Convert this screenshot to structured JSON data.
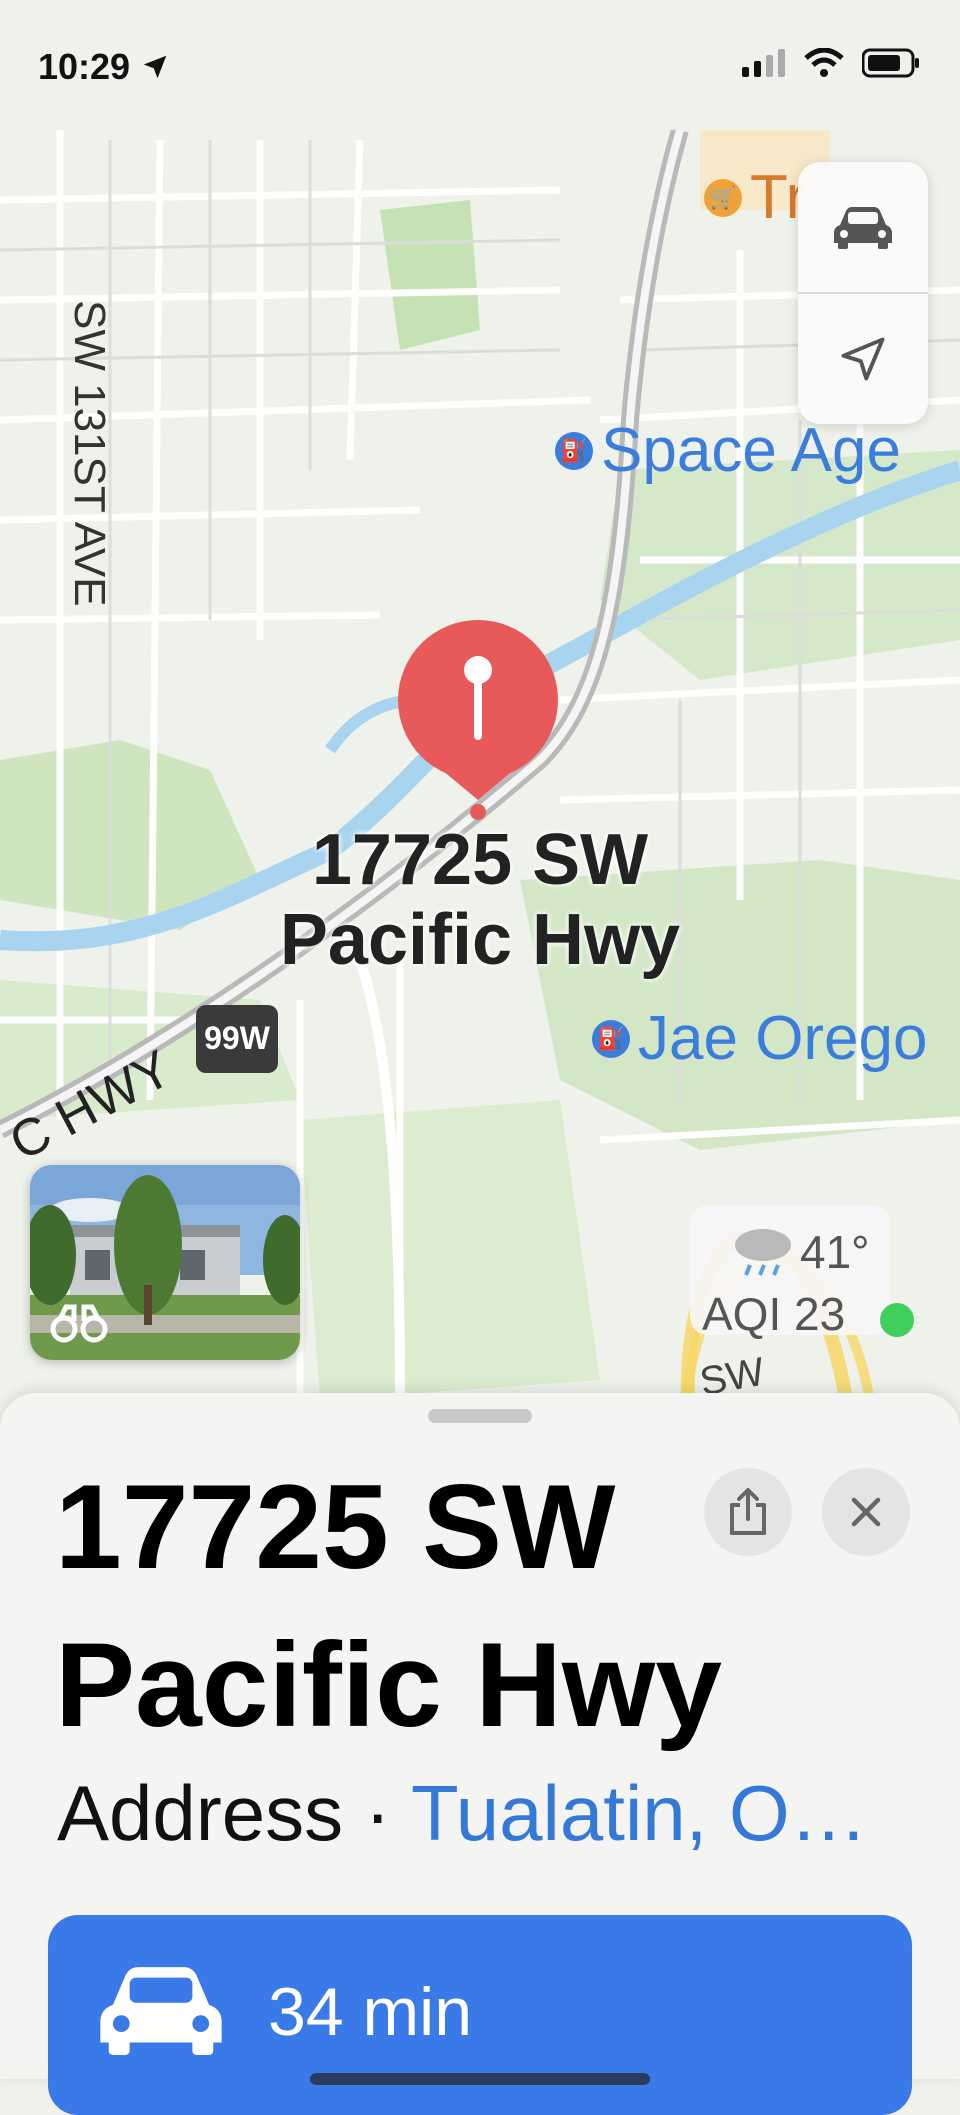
{
  "status_bar": {
    "time": "10:29"
  },
  "map": {
    "street_label": "SW 131ST AVE",
    "highway_label": "C HWY",
    "shield_label": "99W",
    "poi_top_right": "Tr",
    "poi_space_age": "Space Age",
    "poi_jae_oregon": "Jae Orego",
    "pin_label_line1": "17725 SW",
    "pin_label_line2": "Pacific Hwy",
    "road_fragment": "SW"
  },
  "controls": {
    "drive_icon": "car-icon",
    "location_icon": "location-arrow-icon"
  },
  "weather": {
    "temperature": "41°",
    "aqi": "AQI 23",
    "aqi_color": "#3fcf5b"
  },
  "sheet": {
    "title_line1": "17725 SW",
    "title_line2": "Pacific Hwy",
    "subtitle_prefix": "Address · ",
    "subtitle_link": "Tualatin, O…",
    "directions_time": "34 min"
  },
  "colors": {
    "pin": "#e85a5a",
    "accent": "#3a79e8",
    "link": "#3478d8",
    "annotation": "#f6d766"
  }
}
